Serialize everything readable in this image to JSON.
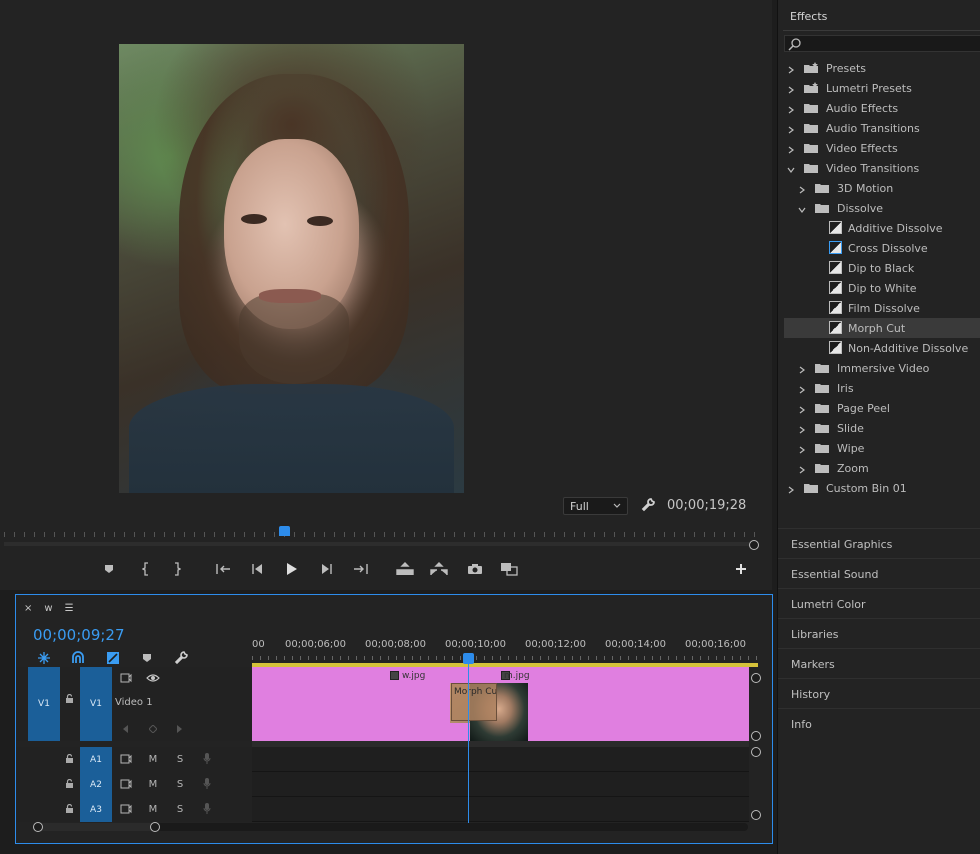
{
  "monitor": {
    "zoom_select": "Full",
    "timecode": "00;00;19;28"
  },
  "timeline": {
    "sequence_name": "w",
    "timecode": "00;00;09;27",
    "ruler_labels": [
      "00",
      "00;00;06;00",
      "00;00;08;00",
      "00;00;10;00",
      "00;00;12;00",
      "00;00;14;00",
      "00;00;16;00"
    ],
    "tracks": {
      "v1": {
        "source": "V1",
        "target": "V1",
        "name": "Video 1"
      },
      "a1": {
        "target": "A1",
        "mute": "M",
        "solo": "S"
      },
      "a2": {
        "target": "A2",
        "mute": "M",
        "solo": "S"
      },
      "a3": {
        "target": "A3",
        "mute": "M",
        "solo": "S"
      }
    },
    "clips": {
      "clip_a": "w.jpg",
      "clip_b": "m.jpg",
      "transition": "Morph Cut"
    }
  },
  "effects": {
    "title": "Effects",
    "tree": [
      {
        "label": "Presets",
        "level": 0,
        "expanded": false
      },
      {
        "label": "Lumetri Presets",
        "level": 0,
        "expanded": false
      },
      {
        "label": "Audio Effects",
        "level": 0,
        "expanded": false
      },
      {
        "label": "Audio Transitions",
        "level": 0,
        "expanded": false
      },
      {
        "label": "Video Effects",
        "level": 0,
        "expanded": false
      },
      {
        "label": "Video Transitions",
        "level": 0,
        "expanded": true
      },
      {
        "label": "3D Motion",
        "level": 1,
        "expanded": false
      },
      {
        "label": "Dissolve",
        "level": 1,
        "expanded": true
      },
      {
        "label": "Additive Dissolve",
        "level": 2
      },
      {
        "label": "Cross Dissolve",
        "level": 2
      },
      {
        "label": "Dip to Black",
        "level": 2
      },
      {
        "label": "Dip to White",
        "level": 2
      },
      {
        "label": "Film Dissolve",
        "level": 2
      },
      {
        "label": "Morph Cut",
        "level": 2,
        "selected": true
      },
      {
        "label": "Non-Additive Dissolve",
        "level": 2
      },
      {
        "label": "Immersive Video",
        "level": 1,
        "expanded": false
      },
      {
        "label": "Iris",
        "level": 1,
        "expanded": false
      },
      {
        "label": "Page Peel",
        "level": 1,
        "expanded": false
      },
      {
        "label": "Slide",
        "level": 1,
        "expanded": false
      },
      {
        "label": "Wipe",
        "level": 1,
        "expanded": false
      },
      {
        "label": "Zoom",
        "level": 1,
        "expanded": false
      },
      {
        "label": "Custom Bin 01",
        "level": 0,
        "expanded": false
      }
    ]
  },
  "side_panels": [
    "Essential Graphics",
    "Essential Sound",
    "Lumetri Color",
    "Libraries",
    "Markers",
    "History",
    "Info"
  ],
  "colors": {
    "accent": "#2d8ceb",
    "clip": "#e07fe0",
    "track_target": "#1b5f99",
    "work_area": "#d5c23a"
  }
}
